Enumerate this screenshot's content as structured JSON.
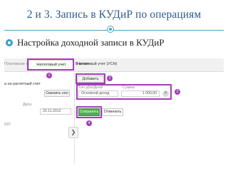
{
  "slide": {
    "title": "2 и 3. Запись в КУДиР по операциям",
    "bullet": "Настройка доходной записи в КУДиР"
  },
  "screenshot": {
    "tabs": {
      "left_label": "Платёжное поручение",
      "active": "Налоговый учет",
      "vat": "В итоге",
      "more": ""
    },
    "left_panel": {
      "account_label": "а на расчетный счет",
      "change_button": "Сменить опл",
      "date_label": "Дата",
      "date_value": "22.11.2012",
      "code_label": "037"
    },
    "right_panel": {
      "header": "Налоговый учет (УСН)",
      "add_row_button": "Добавить строку",
      "income_type_label": "Тип доходной",
      "income_type_value": "Основной доход",
      "amount_label": "Сумма",
      "amount_value": "1 000,00",
      "save_button": "Сохранить",
      "cancel_button": "Отменить",
      "close_glyph": "×"
    },
    "collapse_glyph": "❯",
    "badges": [
      "1",
      "2",
      "3",
      "4"
    ]
  },
  "colors": {
    "title": "#2f5c8a",
    "accent_line": "#4a9fc6",
    "highlight_frame": "#a43dba",
    "save_button": "#4caf50"
  }
}
